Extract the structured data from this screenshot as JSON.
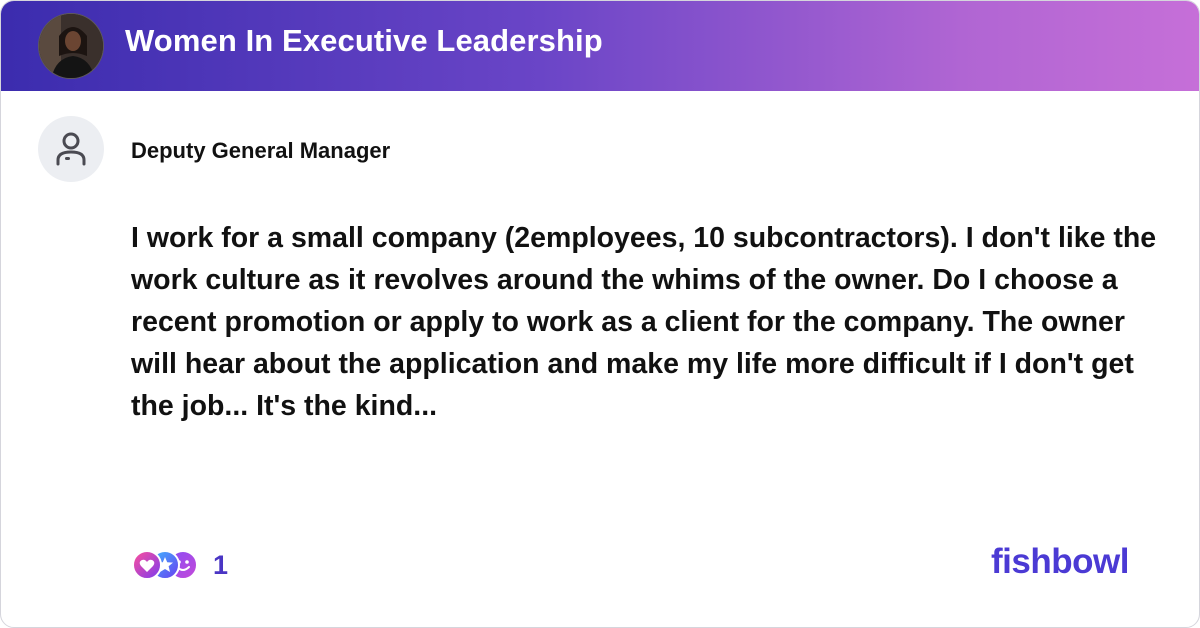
{
  "header": {
    "group_title": "Women In Executive Leadership",
    "group_avatar_icon": "group-photo",
    "gradient": [
      "#3b2cae",
      "#6a45c7",
      "#b065d3",
      "#c66fd8"
    ]
  },
  "post": {
    "author_title": "Deputy General Manager",
    "author_avatar_icon": "anonymous-user-icon",
    "body": "I work for a small company (2employees, 10 subcontractors). I don't like the work culture as it revolves around the whims of the owner. Do I choose a recent promotion or apply to work as a client for the company. The owner will hear about the application and make my life more difficult if I don't get the job... It's the kind..."
  },
  "footer": {
    "reaction_icons": [
      "heart-reaction-icon",
      "star-reaction-icon",
      "smile-reaction-icon"
    ],
    "reaction_count": "1",
    "logo_text": "fishbowl",
    "accent_color": "#4b3ad4"
  }
}
